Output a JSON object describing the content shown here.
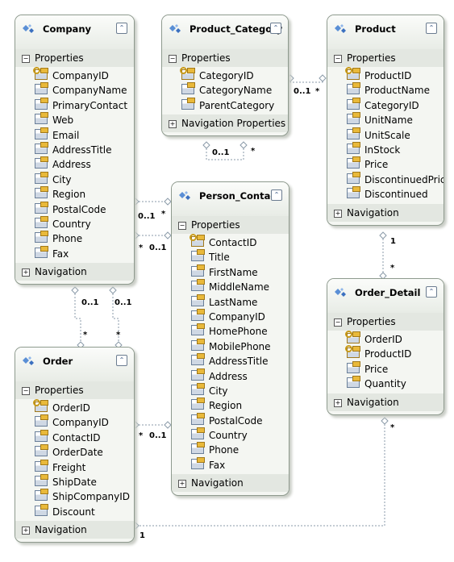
{
  "entities": [
    {
      "id": "company",
      "title": "Company",
      "properties_label": "Properties",
      "navigation_label": "Navigation Properties",
      "properties": [
        {
          "name": "CompanyID",
          "key": true
        },
        {
          "name": "CompanyName"
        },
        {
          "name": "PrimaryContact"
        },
        {
          "name": "Web"
        },
        {
          "name": "Email"
        },
        {
          "name": "AddressTitle"
        },
        {
          "name": "Address"
        },
        {
          "name": "City"
        },
        {
          "name": "Region"
        },
        {
          "name": "PostalCode"
        },
        {
          "name": "Country"
        },
        {
          "name": "Phone"
        },
        {
          "name": "Fax"
        }
      ]
    },
    {
      "id": "product-category",
      "title": "Product_Category",
      "properties_label": "Properties",
      "navigation_label": "Navigation Properties",
      "properties": [
        {
          "name": "CategoryID",
          "key": true
        },
        {
          "name": "CategoryName"
        },
        {
          "name": "ParentCategory"
        }
      ]
    },
    {
      "id": "product",
      "title": "Product",
      "properties_label": "Properties",
      "navigation_label": "Navigation Properties",
      "properties": [
        {
          "name": "ProductID",
          "key": true
        },
        {
          "name": "ProductName"
        },
        {
          "name": "CategoryID"
        },
        {
          "name": "UnitName"
        },
        {
          "name": "UnitScale"
        },
        {
          "name": "InStock"
        },
        {
          "name": "Price"
        },
        {
          "name": "DiscontinuedPrice"
        },
        {
          "name": "Discontinued"
        }
      ]
    },
    {
      "id": "person-contact",
      "title": "Person_Contact",
      "properties_label": "Properties",
      "navigation_label": "Navigation Properties",
      "properties": [
        {
          "name": "ContactID",
          "key": true
        },
        {
          "name": "Title"
        },
        {
          "name": "FirstName"
        },
        {
          "name": "MiddleName"
        },
        {
          "name": "LastName"
        },
        {
          "name": "CompanyID"
        },
        {
          "name": "HomePhone"
        },
        {
          "name": "MobilePhone"
        },
        {
          "name": "AddressTitle"
        },
        {
          "name": "Address"
        },
        {
          "name": "City"
        },
        {
          "name": "Region"
        },
        {
          "name": "PostalCode"
        },
        {
          "name": "Country"
        },
        {
          "name": "Phone"
        },
        {
          "name": "Fax"
        }
      ]
    },
    {
      "id": "order",
      "title": "Order",
      "properties_label": "Properties",
      "navigation_label": "Navigation Properties",
      "properties": [
        {
          "name": "OrderID",
          "key": true
        },
        {
          "name": "CompanyID"
        },
        {
          "name": "ContactID"
        },
        {
          "name": "OrderDate"
        },
        {
          "name": "Freight"
        },
        {
          "name": "ShipDate"
        },
        {
          "name": "ShipCompanyID"
        },
        {
          "name": "Discount"
        }
      ]
    },
    {
      "id": "order-detail",
      "title": "Order_Detail",
      "properties_label": "Properties",
      "navigation_label": "Navigation Properties",
      "properties": [
        {
          "name": "OrderID",
          "key": true
        },
        {
          "name": "ProductID",
          "key": true
        },
        {
          "name": "Price"
        },
        {
          "name": "Quantity"
        }
      ]
    }
  ],
  "associations": [
    {
      "from": "Product_Category",
      "to": "Product_Category",
      "ends": [
        "0..1",
        "*"
      ]
    },
    {
      "from": "Product_Category",
      "to": "Product",
      "ends": [
        "0..1",
        "*"
      ]
    },
    {
      "from": "Company",
      "to": "Person_Contact",
      "ends": [
        "0..1",
        "*"
      ]
    },
    {
      "from": "Person_Contact",
      "to": "Company",
      "ends": [
        "*",
        "0..1"
      ]
    },
    {
      "from": "Company",
      "to": "Order",
      "ends": [
        "0..1",
        "*"
      ]
    },
    {
      "from": "Company",
      "to": "Order",
      "ends": [
        "0..1",
        "*"
      ]
    },
    {
      "from": "Order",
      "to": "Person_Contact",
      "ends": [
        "*",
        "0..1"
      ]
    },
    {
      "from": "Product",
      "to": "Order_Detail",
      "ends": [
        "1",
        "*"
      ]
    },
    {
      "from": "Order",
      "to": "Order_Detail",
      "ends": [
        "1",
        "*"
      ]
    }
  ],
  "colors": {
    "border": "#8e9a8e",
    "band": "#e3e7e1",
    "connector": "#8a9aa8"
  }
}
